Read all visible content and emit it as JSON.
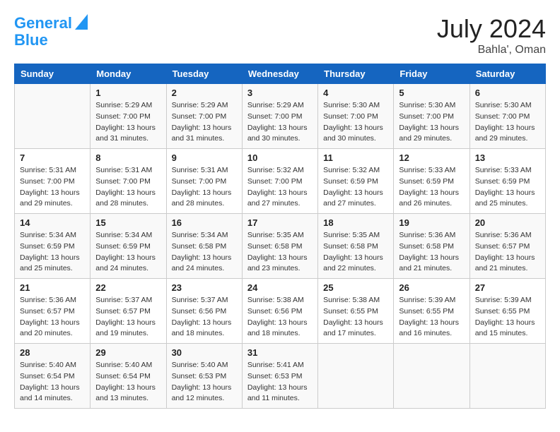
{
  "header": {
    "logo_line1": "General",
    "logo_line2": "Blue",
    "month_year": "July 2024",
    "location": "Bahla', Oman"
  },
  "days_of_week": [
    "Sunday",
    "Monday",
    "Tuesday",
    "Wednesday",
    "Thursday",
    "Friday",
    "Saturday"
  ],
  "weeks": [
    [
      {
        "day": "",
        "info": ""
      },
      {
        "day": "1",
        "info": "Sunrise: 5:29 AM\nSunset: 7:00 PM\nDaylight: 13 hours\nand 31 minutes."
      },
      {
        "day": "2",
        "info": "Sunrise: 5:29 AM\nSunset: 7:00 PM\nDaylight: 13 hours\nand 31 minutes."
      },
      {
        "day": "3",
        "info": "Sunrise: 5:29 AM\nSunset: 7:00 PM\nDaylight: 13 hours\nand 30 minutes."
      },
      {
        "day": "4",
        "info": "Sunrise: 5:30 AM\nSunset: 7:00 PM\nDaylight: 13 hours\nand 30 minutes."
      },
      {
        "day": "5",
        "info": "Sunrise: 5:30 AM\nSunset: 7:00 PM\nDaylight: 13 hours\nand 29 minutes."
      },
      {
        "day": "6",
        "info": "Sunrise: 5:30 AM\nSunset: 7:00 PM\nDaylight: 13 hours\nand 29 minutes."
      }
    ],
    [
      {
        "day": "7",
        "info": "Sunrise: 5:31 AM\nSunset: 7:00 PM\nDaylight: 13 hours\nand 29 minutes."
      },
      {
        "day": "8",
        "info": "Sunrise: 5:31 AM\nSunset: 7:00 PM\nDaylight: 13 hours\nand 28 minutes."
      },
      {
        "day": "9",
        "info": "Sunrise: 5:31 AM\nSunset: 7:00 PM\nDaylight: 13 hours\nand 28 minutes."
      },
      {
        "day": "10",
        "info": "Sunrise: 5:32 AM\nSunset: 7:00 PM\nDaylight: 13 hours\nand 27 minutes."
      },
      {
        "day": "11",
        "info": "Sunrise: 5:32 AM\nSunset: 6:59 PM\nDaylight: 13 hours\nand 27 minutes."
      },
      {
        "day": "12",
        "info": "Sunrise: 5:33 AM\nSunset: 6:59 PM\nDaylight: 13 hours\nand 26 minutes."
      },
      {
        "day": "13",
        "info": "Sunrise: 5:33 AM\nSunset: 6:59 PM\nDaylight: 13 hours\nand 25 minutes."
      }
    ],
    [
      {
        "day": "14",
        "info": "Sunrise: 5:34 AM\nSunset: 6:59 PM\nDaylight: 13 hours\nand 25 minutes."
      },
      {
        "day": "15",
        "info": "Sunrise: 5:34 AM\nSunset: 6:59 PM\nDaylight: 13 hours\nand 24 minutes."
      },
      {
        "day": "16",
        "info": "Sunrise: 5:34 AM\nSunset: 6:58 PM\nDaylight: 13 hours\nand 24 minutes."
      },
      {
        "day": "17",
        "info": "Sunrise: 5:35 AM\nSunset: 6:58 PM\nDaylight: 13 hours\nand 23 minutes."
      },
      {
        "day": "18",
        "info": "Sunrise: 5:35 AM\nSunset: 6:58 PM\nDaylight: 13 hours\nand 22 minutes."
      },
      {
        "day": "19",
        "info": "Sunrise: 5:36 AM\nSunset: 6:58 PM\nDaylight: 13 hours\nand 21 minutes."
      },
      {
        "day": "20",
        "info": "Sunrise: 5:36 AM\nSunset: 6:57 PM\nDaylight: 13 hours\nand 21 minutes."
      }
    ],
    [
      {
        "day": "21",
        "info": "Sunrise: 5:36 AM\nSunset: 6:57 PM\nDaylight: 13 hours\nand 20 minutes."
      },
      {
        "day": "22",
        "info": "Sunrise: 5:37 AM\nSunset: 6:57 PM\nDaylight: 13 hours\nand 19 minutes."
      },
      {
        "day": "23",
        "info": "Sunrise: 5:37 AM\nSunset: 6:56 PM\nDaylight: 13 hours\nand 18 minutes."
      },
      {
        "day": "24",
        "info": "Sunrise: 5:38 AM\nSunset: 6:56 PM\nDaylight: 13 hours\nand 18 minutes."
      },
      {
        "day": "25",
        "info": "Sunrise: 5:38 AM\nSunset: 6:55 PM\nDaylight: 13 hours\nand 17 minutes."
      },
      {
        "day": "26",
        "info": "Sunrise: 5:39 AM\nSunset: 6:55 PM\nDaylight: 13 hours\nand 16 minutes."
      },
      {
        "day": "27",
        "info": "Sunrise: 5:39 AM\nSunset: 6:55 PM\nDaylight: 13 hours\nand 15 minutes."
      }
    ],
    [
      {
        "day": "28",
        "info": "Sunrise: 5:40 AM\nSunset: 6:54 PM\nDaylight: 13 hours\nand 14 minutes."
      },
      {
        "day": "29",
        "info": "Sunrise: 5:40 AM\nSunset: 6:54 PM\nDaylight: 13 hours\nand 13 minutes."
      },
      {
        "day": "30",
        "info": "Sunrise: 5:40 AM\nSunset: 6:53 PM\nDaylight: 13 hours\nand 12 minutes."
      },
      {
        "day": "31",
        "info": "Sunrise: 5:41 AM\nSunset: 6:53 PM\nDaylight: 13 hours\nand 11 minutes."
      },
      {
        "day": "",
        "info": ""
      },
      {
        "day": "",
        "info": ""
      },
      {
        "day": "",
        "info": ""
      }
    ]
  ]
}
